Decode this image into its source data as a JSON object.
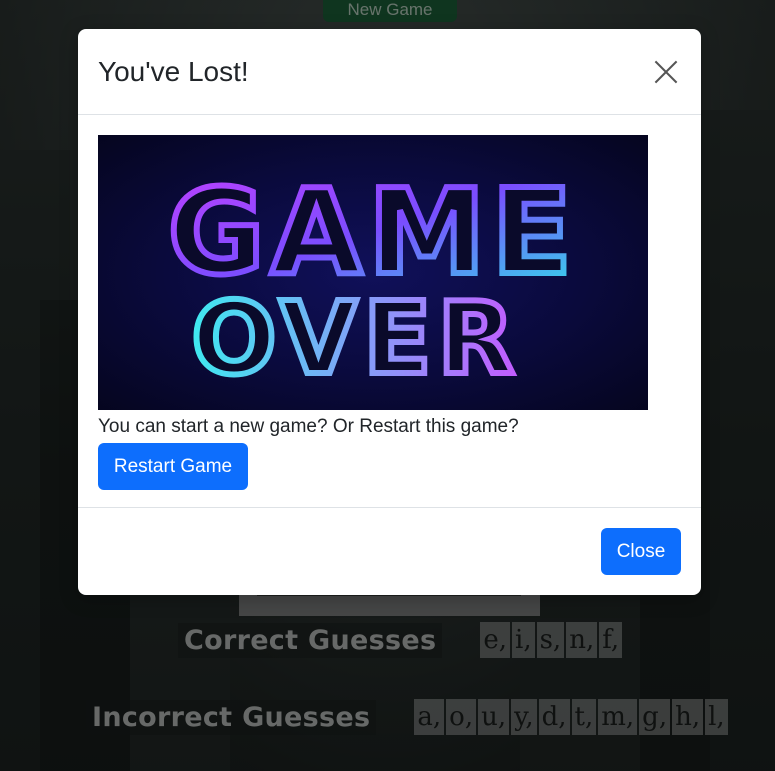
{
  "page": {
    "new_game_label": "New Game"
  },
  "guesses": {
    "correct_label": "Correct Guesses",
    "correct_letters": [
      "e,",
      "i,",
      "s,",
      "n,",
      "f,"
    ],
    "incorrect_label": "Incorrect Guesses",
    "incorrect_letters": [
      "a,",
      "o,",
      "u,",
      "y,",
      "d,",
      "t,",
      "m,",
      "g,",
      "h,",
      "l,"
    ]
  },
  "modal": {
    "title": "You've Lost!",
    "close_icon": "close-icon",
    "image_text_line1": "GAME",
    "image_text_line2": "OVER",
    "message": "You can start a new game? Or Restart this game?",
    "restart_label": "Restart Game",
    "close_label": "Close"
  },
  "colors": {
    "primary": "#0d6efd",
    "new_game": "#1e6b3f"
  }
}
